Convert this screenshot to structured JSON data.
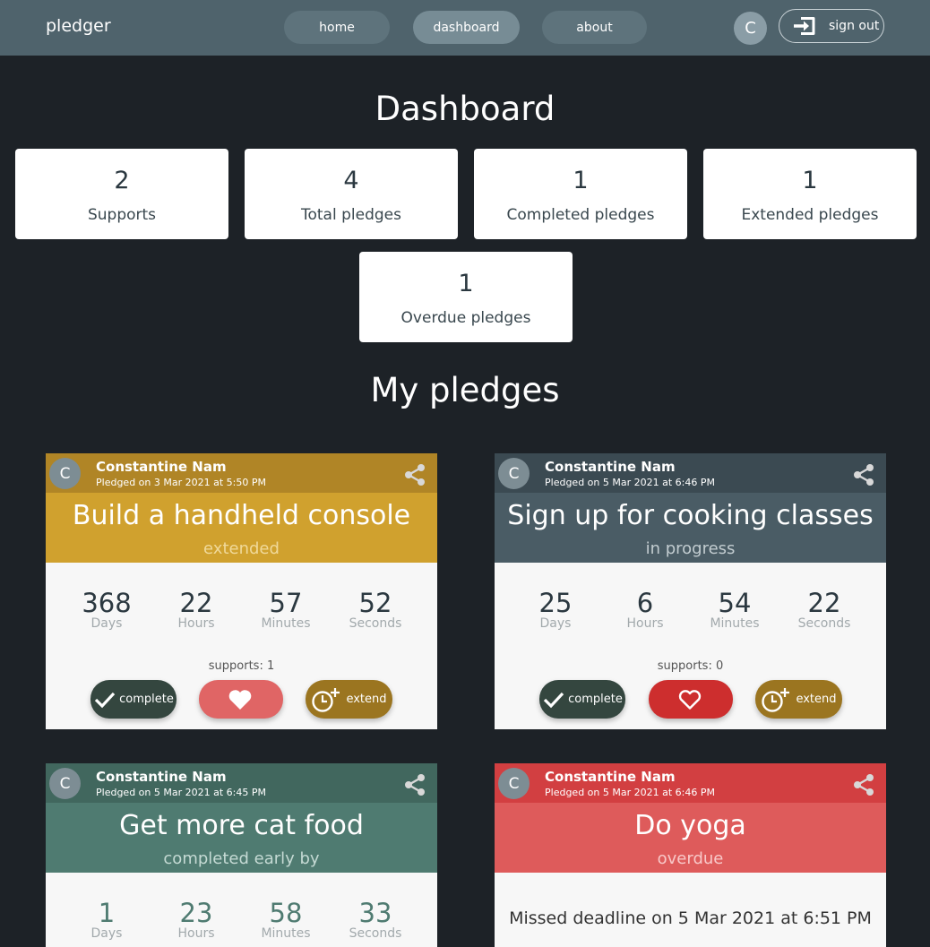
{
  "header": {
    "brand": "pledger",
    "nav": [
      "home",
      "dashboard",
      "about"
    ],
    "active_nav": "dashboard",
    "avatar_letter": "C",
    "signout_label": "sign out"
  },
  "dashboard": {
    "title": "Dashboard",
    "stats": [
      {
        "value": "2",
        "label": "Supports"
      },
      {
        "value": "4",
        "label": "Total pledges"
      },
      {
        "value": "1",
        "label": "Completed pledges"
      },
      {
        "value": "1",
        "label": "Extended pledges"
      },
      {
        "value": "1",
        "label": "Overdue pledges"
      }
    ]
  },
  "my_pledges": {
    "title": "My pledges",
    "cards": [
      {
        "avatar": "C",
        "author": "Constantine Nam",
        "date": "Pledged on 3 Mar 2021 at 5:50 PM",
        "title": "Build a handheld console",
        "status": "extended",
        "head_color": "#d0a12e",
        "who_color": "#b08526",
        "status_color": "#f0d99a",
        "days": "368",
        "hours": "22",
        "minutes": "57",
        "seconds": "52",
        "units": [
          "Days",
          "Hours",
          "Minutes",
          "Seconds"
        ],
        "supports": "supports: 1",
        "complete_label": "complete",
        "extend_label": "extend",
        "heart": "filled"
      },
      {
        "avatar": "C",
        "author": "Constantine Nam",
        "date": "Pledged on 5 Mar 2021 at 6:46 PM",
        "title": "Sign up for cooking classes",
        "status": "in progress",
        "head_color": "#4a5c65",
        "who_color": "#3b4a52",
        "status_color": "#c2ccd0",
        "days": "25",
        "hours": "6",
        "minutes": "54",
        "seconds": "22",
        "units": [
          "Days",
          "Hours",
          "Minutes",
          "Seconds"
        ],
        "supports": "supports: 0",
        "complete_label": "complete",
        "extend_label": "extend",
        "heart": "outline"
      },
      {
        "avatar": "C",
        "author": "Constantine Nam",
        "date": "Pledged on 5 Mar 2021 at 6:45 PM",
        "title": "Get more cat food",
        "status": "completed early by",
        "head_color": "#4f7b71",
        "who_color": "#41675e",
        "status_color": "#c5dad4",
        "days": "1",
        "hours": "23",
        "minutes": "58",
        "seconds": "33",
        "units": [
          "Days",
          "Hours",
          "Minutes",
          "Seconds"
        ]
      },
      {
        "avatar": "C",
        "author": "Constantine Nam",
        "date": "Pledged on 5 Mar 2021 at 6:46 PM",
        "title": "Do yoga",
        "status": "overdue",
        "head_color": "#de5b5b",
        "who_color": "#d23f41",
        "status_color": "#f8c9c9",
        "missed": "Missed deadline on 5 Mar 2021 at 6:51 PM"
      }
    ]
  }
}
